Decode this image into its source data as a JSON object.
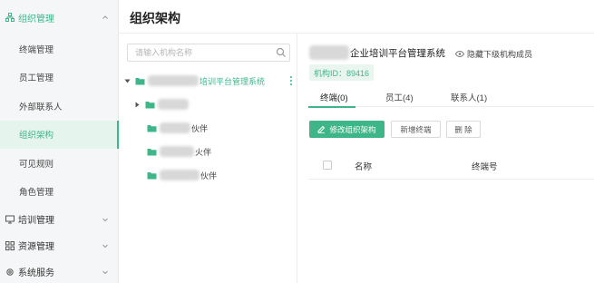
{
  "sidebar": {
    "groups": [
      {
        "label": "组织管理",
        "icon": "org-icon",
        "expanded": true
      },
      {
        "label": "培训管理",
        "icon": "training-icon",
        "expanded": false
      },
      {
        "label": "资源管理",
        "icon": "resource-icon",
        "expanded": false
      },
      {
        "label": "系统服务",
        "icon": "service-icon",
        "expanded": false
      }
    ],
    "items": [
      {
        "label": "终端管理"
      },
      {
        "label": "员工管理"
      },
      {
        "label": "外部联系人"
      },
      {
        "label": "组织架构",
        "active": true
      },
      {
        "label": "可见规则"
      },
      {
        "label": "角色管理"
      }
    ]
  },
  "header": {
    "title": "组织架构"
  },
  "tree": {
    "search_placeholder": "请输入机构名称",
    "root_label": "培训平台管理系统",
    "child1_label": "",
    "child2_label": "伙伴",
    "child3_label": "火伴",
    "child4_label": "伙伴"
  },
  "detail": {
    "org_name": "企业培训平台管理系统",
    "hide_label": "隐藏下级机构成员",
    "org_id": "机构ID：89416",
    "tabs": [
      {
        "label": "终端(0)",
        "active": true
      },
      {
        "label": "员工(4)"
      },
      {
        "label": "联系人(1)"
      }
    ],
    "buttons": {
      "edit": "修改组织架构",
      "add_terminal": "新增终端",
      "delete": "删 除"
    },
    "table": {
      "col_name": "名称",
      "col_terminal": "终端号"
    }
  },
  "colors": {
    "accent": "#3fb58a",
    "active_bg": "#e6f4ee",
    "sidebar_bg": "#f5f6f7"
  }
}
